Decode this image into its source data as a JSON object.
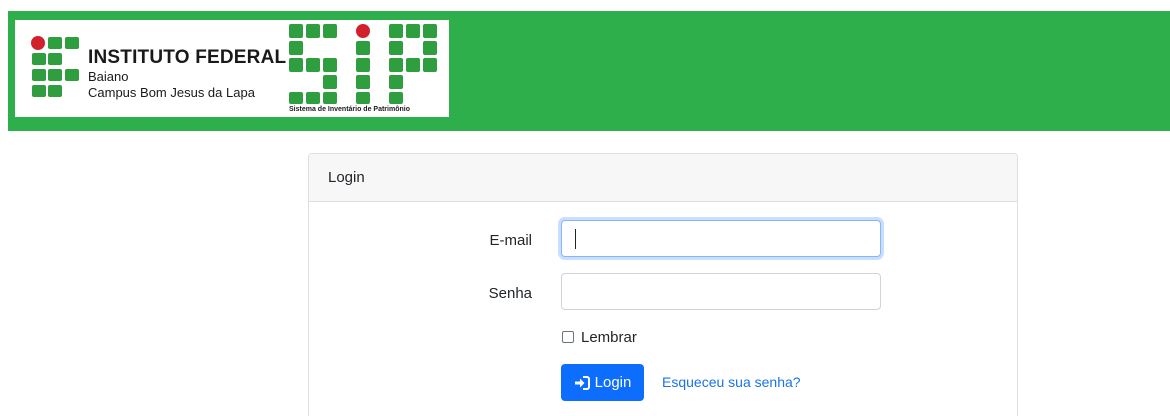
{
  "header": {
    "institution_name": "INSTITUTO FEDERAL",
    "institution_line2": "Baiano",
    "institution_line3": "Campus Bom Jesus da Lapa",
    "sip_caption": "Sistema de Inventário de Patrimônio",
    "sip_logo_text": "SIP"
  },
  "card": {
    "title": "Login",
    "email_label": "E-mail",
    "email_value": "",
    "password_label": "Senha",
    "password_value": "",
    "remember_label": "Lembrar",
    "remember_checked": false,
    "login_button_label": "Login",
    "forgot_link": "Esqueceu sua senha?"
  },
  "colors": {
    "header_green": "#2fae4c",
    "logo_green": "#2e9e3f",
    "logo_red": "#d3212c",
    "primary_button": "#0d6efd",
    "link": "#1a73e8"
  },
  "icons": {
    "login_button_icon": "sign-in-icon"
  }
}
